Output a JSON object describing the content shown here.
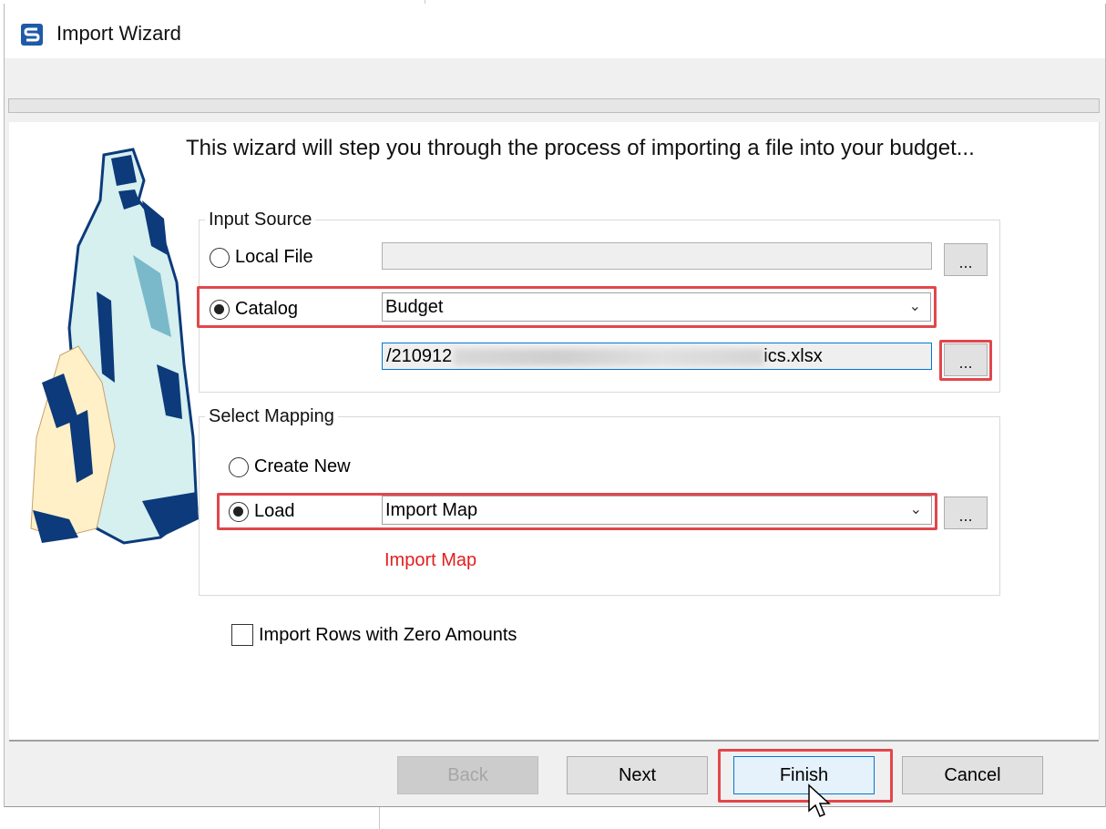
{
  "window": {
    "title": "Import Wizard",
    "icon": "app-logo-icon"
  },
  "intro_text": "This wizard will step you through the process of importing a file into your budget...",
  "input_source": {
    "label": "Input Source",
    "local_file_label": "Local File",
    "local_file_value": "",
    "catalog_label": "Catalog",
    "catalog_selected": "Budget",
    "file_path_start": "/210912",
    "file_path_end": "ics.xlsx",
    "browse_label": "...",
    "selected": "catalog"
  },
  "select_mapping": {
    "label": "Select Mapping",
    "create_new_label": "Create New",
    "load_label": "Load",
    "load_selected": "Import Map",
    "browse_label": "...",
    "map_link": "Import Map",
    "selected": "load"
  },
  "options": {
    "zero_rows_label": "Import Rows with Zero Amounts",
    "zero_rows_checked": false
  },
  "footer": {
    "back_label": "Back",
    "next_label": "Next",
    "finish_label": "Finish",
    "cancel_label": "Cancel"
  },
  "colors": {
    "highlight": "#e0474c",
    "link": "#e02020",
    "primary_border": "#0078d7"
  }
}
